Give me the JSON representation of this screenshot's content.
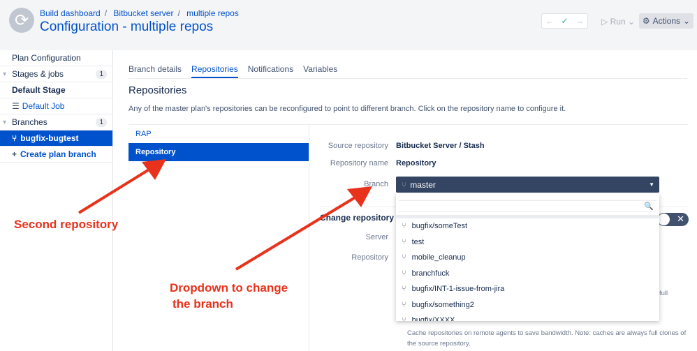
{
  "header": {
    "breadcrumbs": [
      "Build dashboard",
      "Bitbucket server",
      "multiple repos"
    ],
    "title": "Configuration - multiple repos",
    "run_label": "Run",
    "actions_label": "Actions"
  },
  "sidebar": {
    "plan_config": "Plan Configuration",
    "stages_label": "Stages & jobs",
    "stages_count": "1",
    "default_stage": "Default Stage",
    "default_job": "Default Job",
    "branches_label": "Branches",
    "branches_count": "1",
    "active_branch": "bugfix-bugtest",
    "create_branch": "Create plan branch"
  },
  "tabs": [
    "Branch details",
    "Repositories",
    "Notifications",
    "Variables"
  ],
  "main": {
    "heading": "Repositories",
    "description": "Any of the master plan's repositories can be reconfigured to point to different branch. Click on the repository name to configure it.",
    "repos": [
      "RAP",
      "Repository"
    ]
  },
  "details": {
    "source_label": "Source repository",
    "source_value": "Bitbucket Server / Stash",
    "name_label": "Repository name",
    "name_value": "Repository",
    "branch_label": "Branch",
    "branch_value": "master",
    "change_title": "Change repository s",
    "server_label": "Server",
    "repository_label": "Repository",
    "full_text": "full",
    "help_text": "Cache repositories on remote agents to save bandwidth. Note: caches are always full clones of the source repository."
  },
  "dropdown": {
    "options": [
      "bugfix/someTest",
      "test",
      "mobile_cleanup",
      "branchfuck",
      "bugfix/INT-1-issue-from-jira",
      "bugfix/something2",
      "bugfix/XXXX"
    ]
  },
  "annotations": {
    "second_repo": "Second repository",
    "dropdown_line1": "Dropdown to change",
    "dropdown_line2": "the branch",
    "color": "#e8321c"
  }
}
